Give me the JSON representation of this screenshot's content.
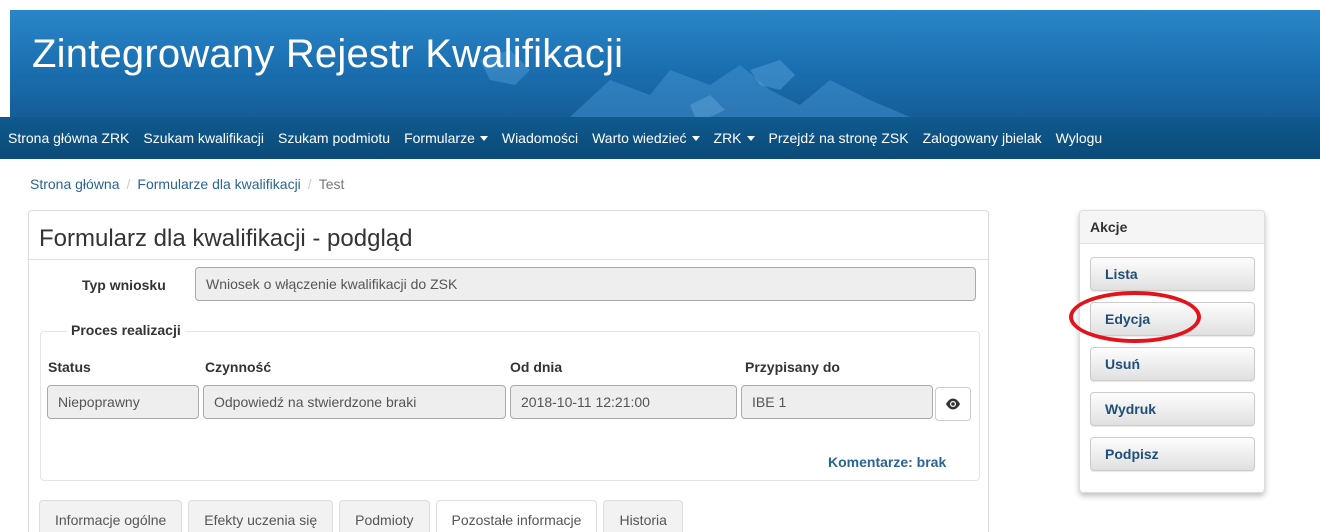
{
  "banner": {
    "title": "Zintegrowany Rejestr Kwalifikacji"
  },
  "nav": {
    "items": [
      {
        "label": "Strona główna ZRK",
        "dropdown": false
      },
      {
        "label": "Szukam kwalifikacji",
        "dropdown": false
      },
      {
        "label": "Szukam podmiotu",
        "dropdown": false
      },
      {
        "label": "Formularze",
        "dropdown": true
      },
      {
        "label": "Wiadomości",
        "dropdown": false
      },
      {
        "label": "Warto wiedzieć",
        "dropdown": true
      },
      {
        "label": "ZRK",
        "dropdown": true
      },
      {
        "label": "Przejdź na stronę ZSK",
        "dropdown": false
      },
      {
        "label": "Zalogowany jbielak",
        "dropdown": false
      },
      {
        "label": "Wylogu",
        "dropdown": false
      }
    ]
  },
  "breadcrumb": {
    "home": "Strona główna",
    "forms": "Formularze dla kwalifikacji",
    "current": "Test"
  },
  "form": {
    "title": "Formularz dla kwalifikacji - podgląd",
    "request_type_label": "Typ wniosku",
    "request_type_value": "Wniosek o włączenie kwalifikacji do ZSK",
    "process_legend": "Proces realizacji",
    "columns": {
      "status": "Status",
      "activity": "Czynność",
      "from_date": "Od dnia",
      "assigned_to": "Przypisany do"
    },
    "row": {
      "status": "Niepoprawny",
      "activity": "Odpowiedź na stwierdzone braki",
      "from_date": "2018-10-11 12:21:00",
      "assigned_to": "IBE 1"
    },
    "comments": "Komentarze: brak"
  },
  "tabs": [
    {
      "label": "Informacje ogólne",
      "active": false
    },
    {
      "label": "Efekty uczenia się",
      "active": false
    },
    {
      "label": "Podmioty",
      "active": false
    },
    {
      "label": "Pozostałe informacje",
      "active": true
    },
    {
      "label": "Historia",
      "active": false
    }
  ],
  "actions": {
    "title": "Akcje",
    "buttons": [
      "Lista",
      "Edycja",
      "Usuń",
      "Wydruk",
      "Podpisz"
    ]
  },
  "colors": {
    "banner": "#1a6fb0",
    "navbar": "#0b4a78",
    "link": "#2a6496",
    "highlight": "#e3121b"
  },
  "icons": {
    "view": "eye-icon"
  }
}
